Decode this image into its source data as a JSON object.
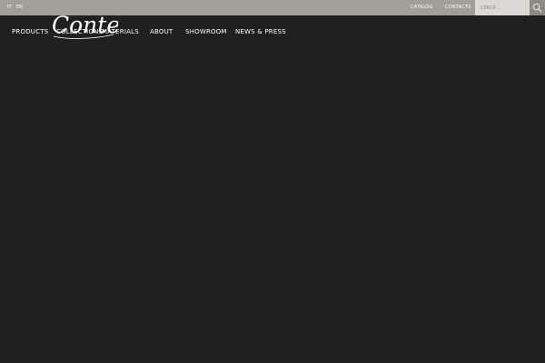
{
  "languages": [
    "IT",
    "EN"
  ],
  "top_links": {
    "catalog": "CATALOG",
    "contacts": "CONTACTS"
  },
  "search": {
    "placeholder": "CERCA ..."
  },
  "logo": {
    "text": "Conte"
  },
  "nav": {
    "items": [
      "PRODUCTS",
      "COLLECTIONS",
      "MATERIALS",
      "ABOUT",
      "SHOWROOM",
      "NEWS & PRESS"
    ]
  },
  "colors": {
    "topbar": "#a29e98",
    "search_box": "#dcd9d5",
    "search_button": "#8d8983",
    "background": "#202020"
  },
  "icons": {
    "search": "search-icon"
  }
}
